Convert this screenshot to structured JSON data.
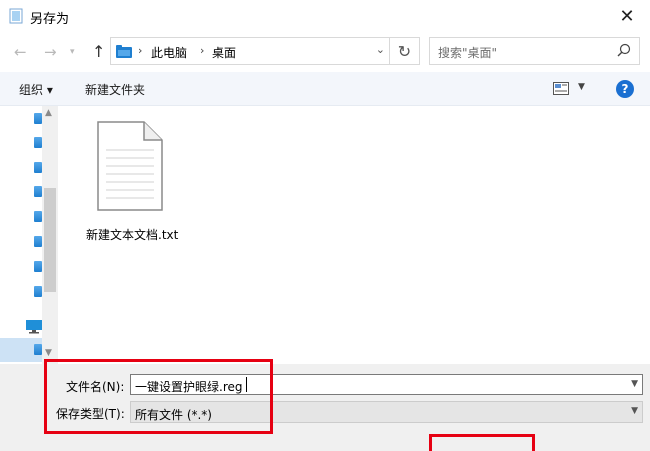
{
  "window": {
    "title": "另存为",
    "close_glyph": "✕"
  },
  "navbar": {
    "back_glyph": "←",
    "forward_glyph": "→",
    "up_glyph": "↑",
    "address": {
      "crumbs": [
        "此电脑",
        "桌面"
      ]
    },
    "refresh_glyph": "↻",
    "search_placeholder": "搜索\"桌面\""
  },
  "toolbar": {
    "organize_label": "组织 ▾",
    "new_folder_label": "新建文件夹",
    "help_label": "?"
  },
  "files": [
    {
      "name": "新建文本文档.txt",
      "icon": "text-file-icon"
    }
  ],
  "form": {
    "filename_label": "文件名(N):",
    "filename_value": "一键设置护眼绿.reg",
    "filetype_label": "保存类型(T):",
    "filetype_value": "所有文件 (*.*)"
  },
  "colors": {
    "highlight_box": "#e60012",
    "toolbar_bg": "#f3f6fb",
    "help_blue": "#1a6fd1",
    "selected_bg": "#cde2f5"
  }
}
